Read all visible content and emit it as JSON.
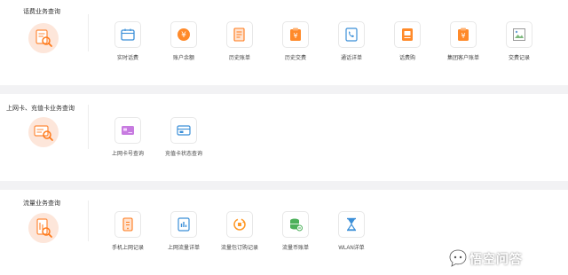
{
  "colors": {
    "accent": "#ff7a1a",
    "blue": "#3b8fd8",
    "green": "#4cb05a",
    "purple": "#b45fd1",
    "hero_bg": "#fde6da"
  },
  "sections": [
    {
      "title": "话费业务查询",
      "icon": "phone-bill-search-icon",
      "items": [
        {
          "label": "实时话费",
          "icon": "wallet-icon"
        },
        {
          "label": "账户余额",
          "icon": "yen-coin-icon"
        },
        {
          "label": "历史账单",
          "icon": "bill-document-icon"
        },
        {
          "label": "历史交费",
          "icon": "payment-yen-icon"
        },
        {
          "label": "通话详单",
          "icon": "call-log-icon"
        },
        {
          "label": "话费购",
          "icon": "shopping-bill-icon"
        },
        {
          "label": "集团客户账单",
          "icon": "group-bill-icon"
        },
        {
          "label": "交费记录",
          "icon": "broken-image-icon"
        }
      ]
    },
    {
      "title": "上网卡、充值卡业务查询",
      "icon": "card-search-icon",
      "items": [
        {
          "label": "上网卡号查询",
          "icon": "internet-card-icon"
        },
        {
          "label": "充值卡状态查询",
          "icon": "recharge-card-icon"
        }
      ]
    },
    {
      "title": "流量业务查询",
      "icon": "data-usage-search-icon",
      "items": [
        {
          "label": "手机上网记录",
          "icon": "mobile-record-icon"
        },
        {
          "label": "上网流量详单",
          "icon": "traffic-detail-icon"
        },
        {
          "label": "流量包订购记录",
          "icon": "package-order-icon"
        },
        {
          "label": "流量币账单",
          "icon": "coin-stack-icon"
        },
        {
          "label": "WLAN详单",
          "icon": "hourglass-icon"
        }
      ]
    }
  ],
  "watermark": {
    "text": "悟空问答",
    "icon": "chat-bubble-icon"
  }
}
